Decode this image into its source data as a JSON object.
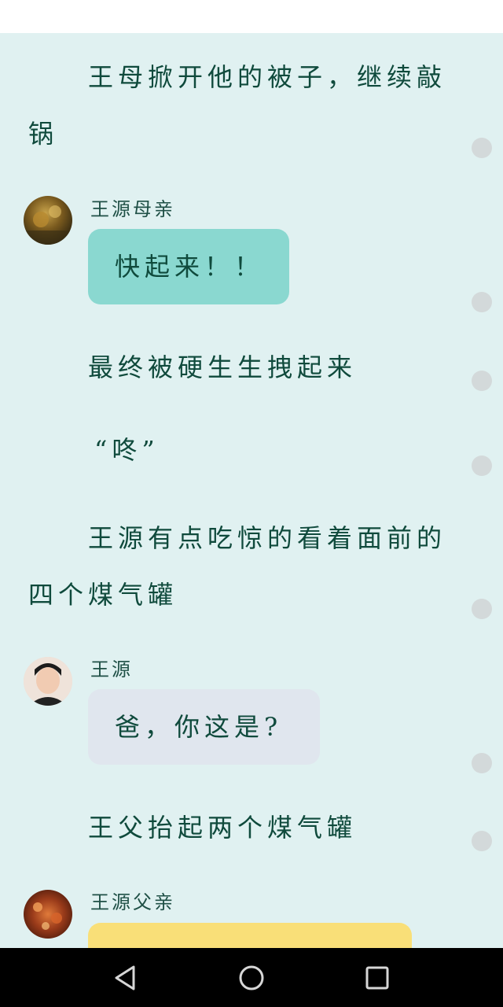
{
  "story": {
    "paragraph_1": "王母掀开他的被子，继续敲锅",
    "speaker_mother": "王源母亲",
    "bubble_mother": "快起来！！",
    "paragraph_2": "最终被硬生生拽起来",
    "paragraph_3": "“咚”",
    "paragraph_4": "王源有点吃惊的看着面前的四个煤气罐",
    "speaker_wangyuan": "王源",
    "bubble_wangyuan": "爸，你这是?",
    "paragraph_5": "王父抬起两个煤气罐",
    "speaker_father": "王源父亲"
  },
  "colors": {
    "page_background": "#e0f1f1",
    "text": "#0f4a3c",
    "bubble_mother": "#8ad8d0",
    "bubble_wangyuan": "#e0e6ee",
    "bubble_father": "#f9df78",
    "comment_dot": "#d3d9da"
  },
  "icons": {
    "nav_back": "back-triangle-icon",
    "nav_home": "home-circle-icon",
    "nav_recents": "recents-square-icon"
  }
}
